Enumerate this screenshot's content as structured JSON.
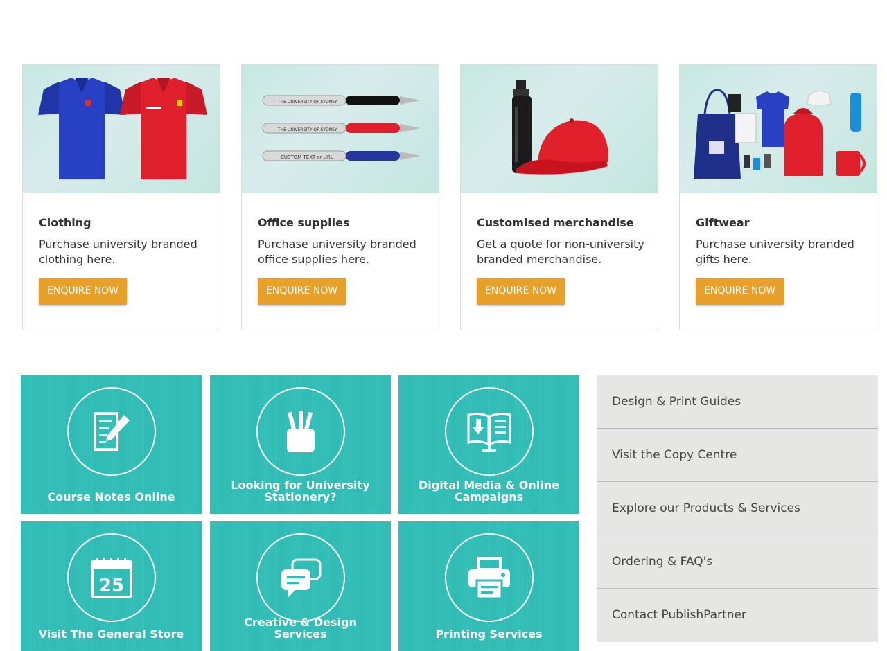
{
  "products": [
    {
      "title": "Clothing",
      "description": "Purchase university branded clothing here.",
      "button": "ENQUIRE NOW",
      "image_icon": "polo-shirts-image"
    },
    {
      "title": "Office supplies",
      "description": "Purchase university branded office supplies here.",
      "button": "ENQUIRE NOW",
      "image_icon": "pens-image",
      "pen_text": [
        "THE UNIVERSITY OF SYDNEY",
        "THE UNIVERSITY OF SYDNEY",
        "CUSTOM TEXT or URL"
      ]
    },
    {
      "title": "Customised merchandise",
      "description": "Get a quote for non-university branded merchandise.",
      "button": "ENQUIRE NOW",
      "image_icon": "bottle-and-cap-image"
    },
    {
      "title": "Giftwear",
      "description": "Purchase university branded gifts here.",
      "button": "ENQUIRE NOW",
      "image_icon": "gift-collection-image"
    }
  ],
  "tiles": [
    {
      "label": "Course Notes Online",
      "icon": "notes-pencil-icon"
    },
    {
      "label": "Looking for University Stationery?",
      "icon": "pencil-cup-icon"
    },
    {
      "label": "Digital Media & Online Campaigns",
      "icon": "digital-book-icon"
    },
    {
      "label": "Visit The General Store",
      "icon": "calendar-icon",
      "calendar_day": "25"
    },
    {
      "label": "Creative & Design Services",
      "icon": "chat-bubbles-icon"
    },
    {
      "label": "Printing Services",
      "icon": "printer-icon"
    }
  ],
  "side_menu": [
    "Design & Print Guides",
    "Visit the Copy Centre",
    "Explore our Products & Services",
    "Ordering & FAQ's",
    "Contact PublishPartner"
  ],
  "colors": {
    "accent_button": "#e7a02a",
    "tile_teal": "#2fbcb5",
    "side_menu_bg": "#e6e6e4"
  }
}
